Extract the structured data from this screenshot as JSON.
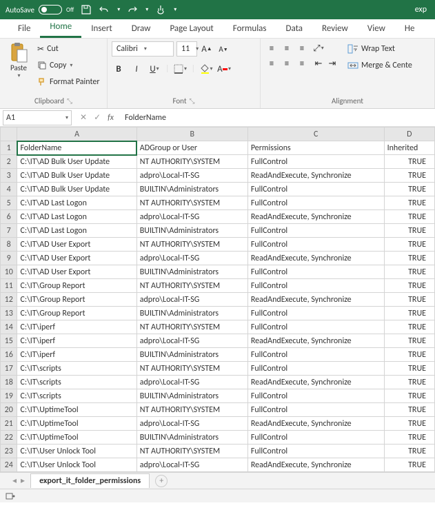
{
  "titlebar": {
    "autosave_label": "AutoSave",
    "autosave_state": "Off",
    "title": "exp"
  },
  "tabs": [
    "File",
    "Home",
    "Insert",
    "Draw",
    "Page Layout",
    "Formulas",
    "Data",
    "Review",
    "View",
    "He"
  ],
  "active_tab": "Home",
  "ribbon": {
    "clipboard": {
      "paste": "Paste",
      "cut": "Cut",
      "copy": "Copy",
      "format_painter": "Format Painter",
      "label": "Clipboard"
    },
    "font": {
      "name": "Calibri",
      "size": "11",
      "label": "Font"
    },
    "alignment": {
      "wrap_text": "Wrap Text",
      "merge_center": "Merge & Cente",
      "label": "Alignment"
    }
  },
  "namebox": "A1",
  "formula": "FolderName",
  "columns": [
    "A",
    "B",
    "C",
    "D"
  ],
  "headers": {
    "A": "FolderName",
    "B": "ADGroup or User",
    "C": "Permissions",
    "D": "Inherited"
  },
  "rows": [
    {
      "n": 2,
      "A": "C:\\IT\\AD Bulk User Update",
      "B": "NT AUTHORITY\\SYSTEM",
      "C": "FullControl",
      "D": "TRUE"
    },
    {
      "n": 3,
      "A": "C:\\IT\\AD Bulk User Update",
      "B": "adpro\\Local-IT-SG",
      "C": "ReadAndExecute, Synchronize",
      "D": "TRUE"
    },
    {
      "n": 4,
      "A": "C:\\IT\\AD Bulk User Update",
      "B": "BUILTIN\\Administrators",
      "C": "FullControl",
      "D": "TRUE"
    },
    {
      "n": 5,
      "A": "C:\\IT\\AD Last Logon",
      "B": "NT AUTHORITY\\SYSTEM",
      "C": "FullControl",
      "D": "TRUE"
    },
    {
      "n": 6,
      "A": "C:\\IT\\AD Last Logon",
      "B": "adpro\\Local-IT-SG",
      "C": "ReadAndExecute, Synchronize",
      "D": "TRUE"
    },
    {
      "n": 7,
      "A": "C:\\IT\\AD Last Logon",
      "B": "BUILTIN\\Administrators",
      "C": "FullControl",
      "D": "TRUE"
    },
    {
      "n": 8,
      "A": "C:\\IT\\AD User Export",
      "B": "NT AUTHORITY\\SYSTEM",
      "C": "FullControl",
      "D": "TRUE"
    },
    {
      "n": 9,
      "A": "C:\\IT\\AD User Export",
      "B": "adpro\\Local-IT-SG",
      "C": "ReadAndExecute, Synchronize",
      "D": "TRUE"
    },
    {
      "n": 10,
      "A": "C:\\IT\\AD User Export",
      "B": "BUILTIN\\Administrators",
      "C": "FullControl",
      "D": "TRUE"
    },
    {
      "n": 11,
      "A": "C:\\IT\\Group Report",
      "B": "NT AUTHORITY\\SYSTEM",
      "C": "FullControl",
      "D": "TRUE"
    },
    {
      "n": 12,
      "A": "C:\\IT\\Group Report",
      "B": "adpro\\Local-IT-SG",
      "C": "ReadAndExecute, Synchronize",
      "D": "TRUE"
    },
    {
      "n": 13,
      "A": "C:\\IT\\Group Report",
      "B": "BUILTIN\\Administrators",
      "C": "FullControl",
      "D": "TRUE"
    },
    {
      "n": 14,
      "A": "C:\\IT\\iperf",
      "B": "NT AUTHORITY\\SYSTEM",
      "C": "FullControl",
      "D": "TRUE"
    },
    {
      "n": 15,
      "A": "C:\\IT\\iperf",
      "B": "adpro\\Local-IT-SG",
      "C": "ReadAndExecute, Synchronize",
      "D": "TRUE"
    },
    {
      "n": 16,
      "A": "C:\\IT\\iperf",
      "B": "BUILTIN\\Administrators",
      "C": "FullControl",
      "D": "TRUE"
    },
    {
      "n": 17,
      "A": "C:\\IT\\scripts",
      "B": "NT AUTHORITY\\SYSTEM",
      "C": "FullControl",
      "D": "TRUE"
    },
    {
      "n": 18,
      "A": "C:\\IT\\scripts",
      "B": "adpro\\Local-IT-SG",
      "C": "ReadAndExecute, Synchronize",
      "D": "TRUE"
    },
    {
      "n": 19,
      "A": "C:\\IT\\scripts",
      "B": "BUILTIN\\Administrators",
      "C": "FullControl",
      "D": "TRUE"
    },
    {
      "n": 20,
      "A": "C:\\IT\\UptimeTool",
      "B": "NT AUTHORITY\\SYSTEM",
      "C": "FullControl",
      "D": "TRUE"
    },
    {
      "n": 21,
      "A": "C:\\IT\\UptimeTool",
      "B": "adpro\\Local-IT-SG",
      "C": "ReadAndExecute, Synchronize",
      "D": "TRUE"
    },
    {
      "n": 22,
      "A": "C:\\IT\\UptimeTool",
      "B": "BUILTIN\\Administrators",
      "C": "FullControl",
      "D": "TRUE"
    },
    {
      "n": 23,
      "A": "C:\\IT\\User Unlock Tool",
      "B": "NT AUTHORITY\\SYSTEM",
      "C": "FullControl",
      "D": "TRUE"
    },
    {
      "n": 24,
      "A": "C:\\IT\\User Unlock Tool",
      "B": "adpro\\Local-IT-SG",
      "C": "ReadAndExecute, Synchronize",
      "D": "TRUE"
    }
  ],
  "sheet_tab": "export_it_folder_permissions"
}
